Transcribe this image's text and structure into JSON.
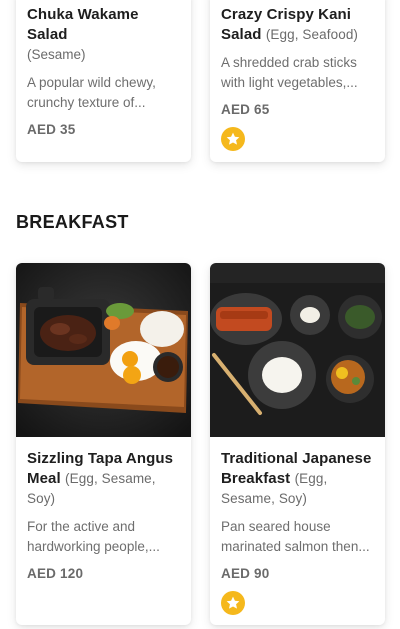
{
  "salads": [
    {
      "name": "Chuka Wakame Salad",
      "tags": "(Sesame)",
      "description": "A popular wild chewy, crunchy texture of...",
      "price": "AED 35",
      "badge": false
    },
    {
      "name": "Crazy Crispy Kani Salad",
      "tags": "(Egg, Seafood)",
      "description": "A shredded crab sticks with light vegetables,...",
      "price": "AED 65",
      "badge": true,
      "badge_icon": "star-icon"
    }
  ],
  "section": {
    "title": "BREAKFAST"
  },
  "breakfast": [
    {
      "name": "Sizzling Tapa Angus Meal",
      "tags": "(Egg, Sesame, Soy)",
      "description": "For the active and hardworking people,...",
      "price": "AED 120",
      "badge": false,
      "image_icon": "food-photo-tapa"
    },
    {
      "name": "Traditional Japanese Breakfast",
      "tags": "(Egg, Sesame, Soy)",
      "description": "Pan seared house marinated salmon then...",
      "price": "AED 90",
      "badge": true,
      "badge_icon": "star-icon",
      "image_icon": "food-photo-japanese-breakfast"
    }
  ],
  "colors": {
    "badge": "#f5b81c",
    "background": "#ffffff"
  }
}
